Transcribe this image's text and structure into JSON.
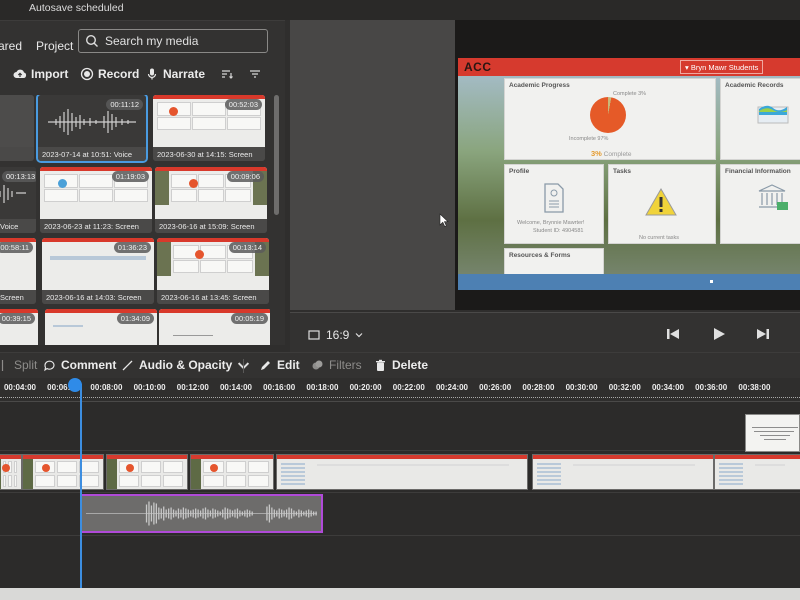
{
  "status": {
    "autosave": "Autosave scheduled"
  },
  "media": {
    "tabs": [
      {
        "label": "ared"
      },
      {
        "label": "Project"
      }
    ],
    "search_placeholder": "Search my media",
    "actions": [
      {
        "label": "Import",
        "icon": "cloud-upload-icon"
      },
      {
        "label": "Record",
        "icon": "record-icon"
      },
      {
        "label": "Narrate",
        "icon": "microphone-icon"
      }
    ],
    "sort_icon": "sort-icon",
    "filter_icon": "filter-icon",
    "items": [
      {
        "caption": "",
        "duration": "",
        "type": "blank"
      },
      {
        "caption": "2023-07-14 at 10:51: Voice",
        "duration": "00:11:12",
        "type": "voice",
        "selected": true
      },
      {
        "caption": "2023-06-30 at 14:15: Screen",
        "duration": "00:52:03",
        "type": "screen"
      },
      {
        "caption": "Voice",
        "duration": "00:13:13",
        "type": "voice"
      },
      {
        "caption": "2023-06-23 at 11:23: Screen",
        "duration": "01:19:03",
        "type": "screen"
      },
      {
        "caption": "2023-06-16 at 15:09: Screen",
        "duration": "00:09:06",
        "type": "screen-photo"
      },
      {
        "caption": "Screen",
        "duration": "00:58:11",
        "type": "doc"
      },
      {
        "caption": "2023-06-16 at 14:03: Screen",
        "duration": "01:36:23",
        "type": "doc"
      },
      {
        "caption": "2023-06-16 at 13:45: Screen",
        "duration": "00:13:14",
        "type": "screen-photo"
      },
      {
        "caption": "",
        "duration": "00:39:15",
        "type": "doc"
      },
      {
        "caption": "",
        "duration": "01:34:09",
        "type": "doc"
      },
      {
        "caption": "",
        "duration": "00:05:19",
        "type": "doc"
      }
    ]
  },
  "preview": {
    "logo": "ACC",
    "institution": "▾ Bryn Mawr Students",
    "cards": {
      "academic_progress": {
        "title": "Academic Progress",
        "complete_label": "Complete 3%",
        "incomplete_label": "Incomplete 97%",
        "percent": "3%",
        "percent_suffix": "Complete"
      },
      "academic_records": {
        "title": "Academic Records"
      },
      "profile": {
        "title": "Profile",
        "welcome": "Welcome, Brynnie Mawrter!",
        "student_id": "Student ID: 4904581"
      },
      "tasks": {
        "title": "Tasks",
        "empty": "No current tasks"
      },
      "financial": {
        "title": "Financial Information"
      },
      "resources": {
        "title": "Resources & Forms"
      }
    },
    "progress_fraction": 0.03
  },
  "player": {
    "aspect_ratio": "16:9",
    "controls": [
      "skip-back-icon",
      "play-icon",
      "skip-forward-icon"
    ]
  },
  "timeline_toolbar": {
    "split": "Split",
    "comment": "Comment",
    "audio_opacity": "Audio & Opacity",
    "edit": "Edit",
    "filters": "Filters",
    "delete": "Delete"
  },
  "ruler": {
    "ticks": [
      "00:04:00",
      "00:06:00",
      "00:08:00",
      "00:10:00",
      "00:12:00",
      "00:14:00",
      "00:16:00",
      "00:18:00",
      "00:20:00",
      "00:22:00",
      "00:24:00",
      "00:26:00",
      "00:28:00",
      "00:30:00",
      "00:32:00",
      "00:34:00",
      "00:36:00",
      "00:38:00"
    ],
    "playhead_time_minutes": 6.2
  },
  "colors": {
    "accent_blue": "#2f8be8",
    "audio_selected": "#b04ad8",
    "brand_red": "#d63a2e"
  }
}
